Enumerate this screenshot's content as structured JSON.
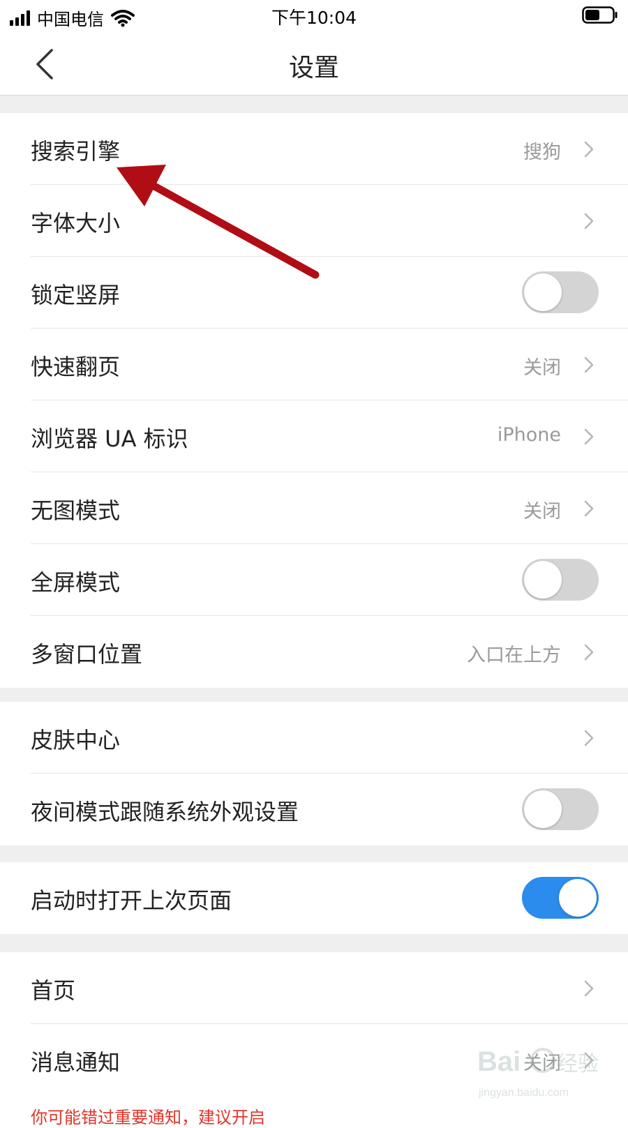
{
  "status_bar": {
    "carrier": "中国电信",
    "time": "下午10:04",
    "icons": [
      "signal-icon",
      "wifi-icon",
      "battery-icon"
    ]
  },
  "nav": {
    "title": "设置",
    "back_icon": "chevron-left-icon"
  },
  "groups": [
    {
      "items": [
        {
          "label": "搜索引擎",
          "value": "搜狗",
          "control": "chevron"
        },
        {
          "label": "字体大小",
          "value": "",
          "control": "chevron"
        },
        {
          "label": "锁定竖屏",
          "control": "toggle",
          "on": false
        },
        {
          "label": "快速翻页",
          "value": "关闭",
          "control": "chevron"
        },
        {
          "label": "浏览器 UA 标识",
          "value": "iPhone",
          "control": "chevron"
        },
        {
          "label": "无图模式",
          "value": "关闭",
          "control": "chevron"
        },
        {
          "label": "全屏模式",
          "control": "toggle",
          "on": false
        },
        {
          "label": "多窗口位置",
          "value": "入口在上方",
          "control": "chevron"
        }
      ]
    },
    {
      "items": [
        {
          "label": "皮肤中心",
          "value": "",
          "control": "chevron"
        },
        {
          "label": "夜间模式跟随系统外观设置",
          "control": "toggle",
          "on": false
        }
      ]
    },
    {
      "items": [
        {
          "label": "启动时打开上次页面",
          "control": "toggle",
          "on": true
        }
      ]
    },
    {
      "items": [
        {
          "label": "首页",
          "value": "",
          "control": "chevron"
        },
        {
          "label": "消息通知",
          "value": "关闭",
          "control": "chevron",
          "sublabel": "你可能错过重要通知，建议开启"
        }
      ]
    }
  ],
  "colors": {
    "toggle_on": "#2b8cee",
    "toggle_off": "#d4d4d4",
    "warning_text": "#e0352b",
    "annotation_arrow": "#b00e14"
  },
  "watermark": {
    "text": "Baidu经验",
    "url_text": "jingyan.baidu.com"
  }
}
